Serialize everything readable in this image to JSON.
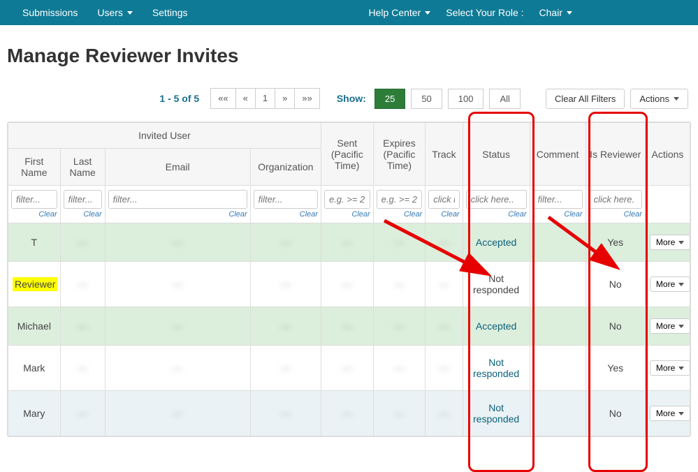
{
  "nav": {
    "submissions": "Submissions",
    "users": "Users",
    "settings": "Settings",
    "help": "Help Center",
    "role_label": "Select Your Role :",
    "role_value": "Chair"
  },
  "page_title": "Manage Reviewer Invites",
  "pager": {
    "info": "1 - 5 of 5",
    "first": "««",
    "prev": "«",
    "page": "1",
    "next": "»",
    "last": "»»"
  },
  "show": {
    "label": "Show:",
    "o25": "25",
    "o50": "50",
    "o100": "100",
    "oall": "All"
  },
  "buttons": {
    "clear_filters": "Clear All Filters",
    "actions": "Actions",
    "more": "More"
  },
  "headers": {
    "invited_user": "Invited User",
    "first_name": "First Name",
    "last_name": "Last Name",
    "email": "Email",
    "organization": "Organization",
    "sent": "Sent (Pacific Time)",
    "expires": "Expires (Pacific Time)",
    "track": "Track",
    "status": "Status",
    "comment": "Comment",
    "is_reviewer": "Is Reviewer",
    "actions": "Actions"
  },
  "filters": {
    "text_ph": "filter...",
    "date_ph": "e.g. >= 2",
    "click_ph": "click here..",
    "click_short": "click h",
    "click_here": "click here.",
    "clear": "Clear"
  },
  "rows": [
    {
      "first": "T",
      "last": "—",
      "email": "—",
      "org": "—",
      "sent": "—",
      "exp": "—",
      "track": "—",
      "status": "Accepted",
      "status_class": "status-accepted",
      "comment": "",
      "is_reviewer": "Yes",
      "row_class": "accepted-row",
      "hl": false
    },
    {
      "first": "Reviewer",
      "last": "—",
      "email": "—",
      "org": "—",
      "sent": "—",
      "exp": "—",
      "track": "—",
      "status": "Not responded",
      "status_class": "",
      "comment": "",
      "is_reviewer": "No",
      "row_class": "",
      "hl": true
    },
    {
      "first": "Michael",
      "last": "—",
      "email": "—",
      "org": "—",
      "sent": "—",
      "exp": "—",
      "track": "—",
      "status": "Accepted",
      "status_class": "status-accepted",
      "comment": "",
      "is_reviewer": "No",
      "row_class": "accepted-row",
      "hl": false
    },
    {
      "first": "Mark",
      "last": "—",
      "email": "—",
      "org": "—",
      "sent": "—",
      "exp": "—",
      "track": "—",
      "status": "Not responded",
      "status_class": "status-link",
      "comment": "",
      "is_reviewer": "Yes",
      "row_class": "",
      "hl": false
    },
    {
      "first": "Mary",
      "last": "—",
      "email": "—",
      "org": "—",
      "sent": "—",
      "exp": "—",
      "track": "—",
      "status": "Not responded",
      "status_class": "status-link",
      "comment": "",
      "is_reviewer": "No",
      "row_class": "hover-row",
      "hl": false
    }
  ]
}
